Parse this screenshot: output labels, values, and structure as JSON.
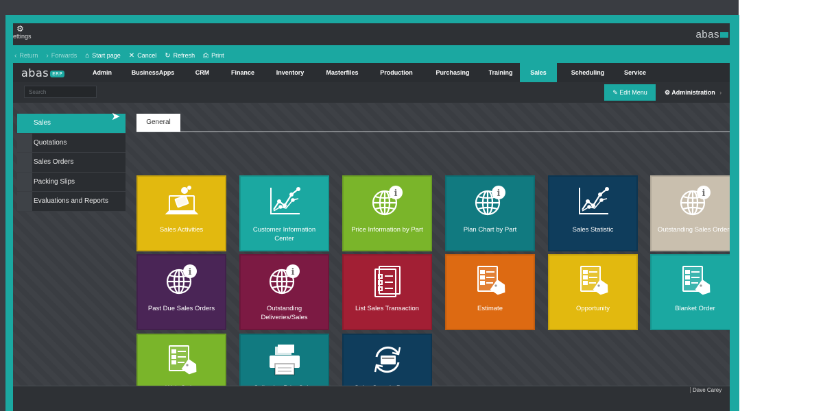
{
  "titlebar": {
    "settings_label": "ettings",
    "brand": "abas"
  },
  "toolbar": {
    "items": [
      {
        "label": "Return",
        "icon": "chevron-left-icon",
        "enabled": false
      },
      {
        "label": "Forwards",
        "icon": "chevron-right-icon",
        "enabled": false
      },
      {
        "label": "Start page",
        "icon": "home-icon",
        "enabled": true
      },
      {
        "label": "Cancel",
        "icon": "close-icon",
        "enabled": true
      },
      {
        "label": "Refresh",
        "icon": "refresh-icon",
        "enabled": true
      },
      {
        "label": "Print",
        "icon": "print-icon",
        "enabled": true
      }
    ]
  },
  "nav": {
    "logo": "abas",
    "logo_badge": "ERP",
    "items": [
      "Admin",
      "BusinessApps",
      "CRM",
      "Finance",
      "Inventory",
      "Masterfiles",
      "Production",
      "Purchasing",
      "Training",
      "Sales",
      "Scheduling",
      "Service"
    ],
    "active": "Sales"
  },
  "subbar": {
    "search_placeholder": "Search",
    "edit_menu_label": "Edit Menu",
    "administration_label": "Administration"
  },
  "sidebar": {
    "items": [
      {
        "label": "Sales",
        "active": true
      },
      {
        "label": "Quotations",
        "active": false
      },
      {
        "label": "Sales Orders",
        "active": false
      },
      {
        "label": "Packing Slips",
        "active": false
      },
      {
        "label": "Evaluations and Reports",
        "active": false
      }
    ]
  },
  "tabs": {
    "general": "General"
  },
  "tiles": [
    {
      "label": "Sales Activities",
      "color": "#e2b90f",
      "icon": "money-laptop-icon"
    },
    {
      "label": "Customer Information Center",
      "color": "#1ba8a1",
      "icon": "line-chart-icon"
    },
    {
      "label": "Price Information by Part",
      "color": "#7ab52a",
      "icon": "globe-info-icon"
    },
    {
      "label": "Plan Chart by Part",
      "color": "#117a80",
      "icon": "globe-info-icon"
    },
    {
      "label": "Sales Statistic",
      "color": "#0f3d5c",
      "icon": "line-chart-icon"
    },
    {
      "label": "Outstanding Sales Orders",
      "color": "#c9bfae",
      "icon": "globe-info-icon"
    },
    {
      "label": "Past Due Sales Orders",
      "color": "#4a2556",
      "icon": "globe-info-icon"
    },
    {
      "label": "Outstanding Deliveries/Sales",
      "color": "#7c1a43",
      "icon": "globe-info-icon"
    },
    {
      "label": "List Sales Transaction",
      "color": "#a21f34",
      "icon": "checklist-icon"
    },
    {
      "label": "Estimate",
      "color": "#dd6a12",
      "icon": "list-tag-icon"
    },
    {
      "label": "Opportunity",
      "color": "#e2b90f",
      "icon": "list-tag-icon"
    },
    {
      "label": "Blanket Order",
      "color": "#1ba8a1",
      "icon": "list-tag-icon"
    },
    {
      "label": "Web Order",
      "color": "#7ab52a",
      "icon": "list-tag-icon"
    },
    {
      "label": "Collective Print Sales",
      "color": "#117a80",
      "icon": "printer-icon"
    },
    {
      "label": "Sales Sample Process",
      "color": "#0f3d5c",
      "icon": "card-cycle-icon"
    }
  ],
  "footer": {
    "user": "Dave Carey"
  }
}
